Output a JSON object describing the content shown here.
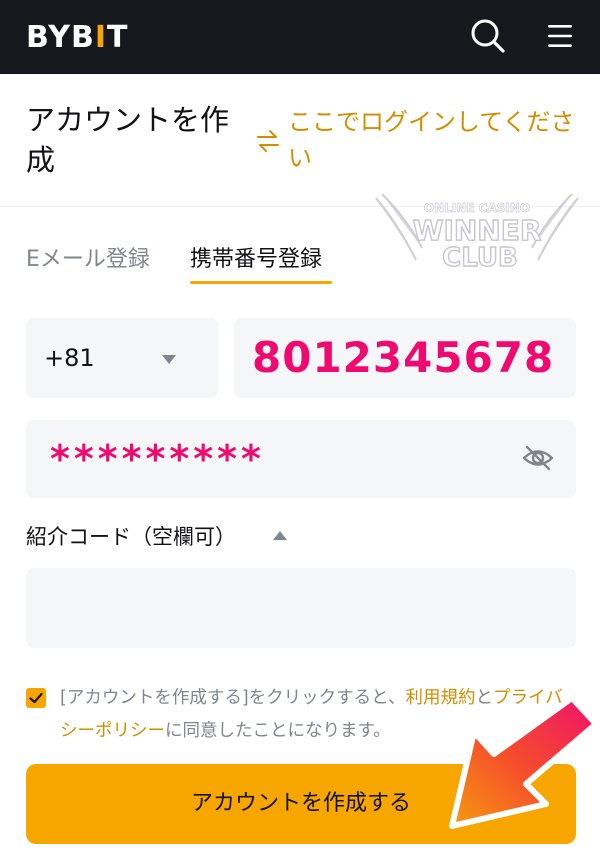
{
  "topbar": {
    "logo_prefix": "BYB",
    "logo_accent": "I",
    "logo_suffix": "T",
    "search_icon": "search-icon",
    "menu_icon": "hamburger-menu-icon"
  },
  "header": {
    "title": "アカウントを作成",
    "login_link": "ここでログインしてください",
    "swap_icon": "swap-arrows-icon"
  },
  "tabs": [
    {
      "label": "Eメール登録",
      "active": false
    },
    {
      "label": "携帯番号登録",
      "active": true
    }
  ],
  "form": {
    "country_code": "+81",
    "phone_value": "8012345678",
    "password_value": "*********",
    "password_toggle_icon": "eye-slash-icon",
    "referral_label": "紹介コード（空欄可）",
    "referral_value": ""
  },
  "terms": {
    "checked": true,
    "prefix": "[アカウントを作成する]をクリックすると、",
    "terms_link": "利用規約",
    "conjunction": "と",
    "privacy_link": "プライバシーポリシー",
    "suffix": "に同意したことになります。"
  },
  "create_button": {
    "label": "アカウントを作成する"
  },
  "watermark": {
    "line1": "ONLINE CASINO",
    "line2": "WINNER",
    "line3": "CLUB"
  },
  "colors": {
    "brand": "#f7a600",
    "link": "#d38e00",
    "highlight": "#ee0a6e",
    "topbar": "#17181e"
  }
}
